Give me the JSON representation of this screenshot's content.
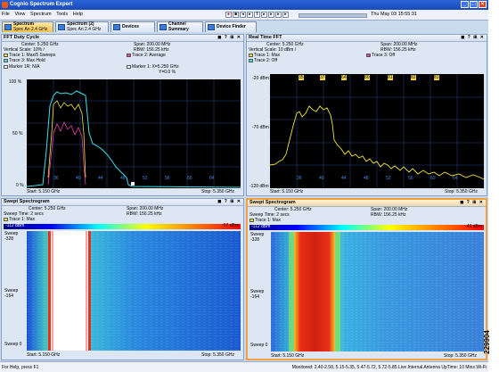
{
  "app": {
    "title": "Cognio Spectrum Expert"
  },
  "window_controls": [
    "_",
    "□",
    "×"
  ],
  "menu": [
    "File",
    "View",
    "Spectrum",
    "Tools",
    "Help"
  ],
  "datetime": "Thu May 03 15:55:31",
  "tabs": [
    {
      "label": "Spectrum",
      "sub": "Spec An 2.4 GHz"
    },
    {
      "label": "Spectrum (2)",
      "sub": "Spec An 2.4 GHz"
    },
    {
      "label": "Devices",
      "sub": ""
    },
    {
      "label": "Channel",
      "sub": "Summary"
    },
    {
      "label": "Device Finder",
      "sub": ""
    }
  ],
  "panels": {
    "fft_duty": {
      "title": "FFT Duty Cycle",
      "center": "Center: 5.250 GHz",
      "span": "Span: 200.00 MHz",
      "vscale": "Vertical Scale: 10% /",
      "rbw": "RBW: 156.25 kHz",
      "trace1": "Trace 1: Max/5 Sweeps",
      "trace2": "Trace 2: Average",
      "trace3": "Trace 3: Max Hold",
      "marker1r": "Marker 1R:",
      "marker1r_val": "N/A",
      "marker1": "Marker 1:",
      "marker1_x": "X=5.250 GHz",
      "marker1_y": "Y=0.0 %",
      "y_top": "100 %",
      "y_mid": "50 %",
      "y_bot": "0 %",
      "channels": [
        "36",
        "40",
        "44",
        "48",
        "52",
        "56",
        "60",
        "64"
      ],
      "start": "Start: 5.150 GHz",
      "stop": "Stop: 5.350 GHz"
    },
    "rt_fft": {
      "title": "Real Time FFT",
      "center": "Center: 5.250 GHz",
      "span": "Span: 200.00 MHz",
      "vscale": "Vertical Scale: 10 dBm /",
      "rbw": "RBW: 156.25 kHz",
      "trace1": "Trace 1: Max",
      "trace2": "Trace 2: Off",
      "trace3": "Trace 3: Off",
      "y_top": "-20 dBm",
      "y_mid": "-70 dBm",
      "y_bot": "-120 dBm",
      "channels_top": [
        "35",
        "37",
        "64",
        "80",
        "81",
        "82",
        "81"
      ],
      "channels_bot": [
        "36",
        "40",
        "44",
        "48",
        "52",
        "56",
        "60",
        "64"
      ],
      "start": "Start: 5.150 GHz",
      "stop": "Stop: 5.350 GHz"
    },
    "swept1": {
      "title": "Swept Spectrogram",
      "center": "Center: 5.250 GHz",
      "span": "Span: 200.00 MHz",
      "sweeptime": "Sweep Time: 2 secs",
      "rbw": "RBW: 156.25 kHz",
      "trace1": "Trace 1: Max",
      "bar_left": "-112 dBm",
      "bar_right": "-57 dBm",
      "y_top": "Sweep -328",
      "y_mid": "Sweep -164",
      "y_bot": "Sweep 0",
      "start": "Start: 5.150 GHz",
      "stop": "Stop: 5.350 GHz"
    },
    "swept2": {
      "title": "Swept Spectrogram",
      "center": "Center: 5.250 GHz",
      "span": "Span: 200.00 MHz",
      "sweeptime": "Sweep Time: 2 secs",
      "rbw": "RBW: 156.25 kHz",
      "trace1": "Trace 1: Max",
      "bar_left": "-112 dBm",
      "bar_right": "-43 dBm",
      "y_top": "Sweep -328",
      "y_mid": "Sweep -164",
      "y_bot": "Sweep 0",
      "start": "Start: 5.150 GHz",
      "stop": "Stop: 5.350 GHz"
    }
  },
  "status": {
    "left": "For Help, press F1",
    "right": "Monitored: 2.40-2.50, 5.15-5.35, 5.47-5.72, 5.72-5.85   Live   Internal Antenna   UpTime: 10 Mins   Wi-Fi"
  },
  "figure_id": "229904",
  "colors": {
    "trace_yellow": "#f2e33a",
    "trace_cyan": "#3fe0e8",
    "trace_magenta": "#e83fb0",
    "accent_blue": "#4a8ae8"
  }
}
